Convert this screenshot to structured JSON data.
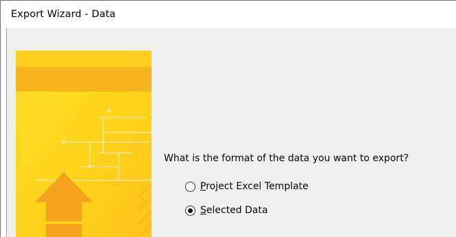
{
  "window": {
    "title": "Export Wizard - Data"
  },
  "banner": {
    "icon": "export-upload-arrow-banner",
    "colors": {
      "top": "#ffd81a",
      "band": "#f7b41c",
      "arrow": "#f5a21c",
      "edge": "#ffc21c"
    }
  },
  "content": {
    "question": "What is the format of the data you want to export?",
    "options": [
      {
        "mnemonic": "P",
        "rest": "roject Excel Template",
        "checked": false
      },
      {
        "mnemonic": "S",
        "rest": "elected Data",
        "checked": true
      }
    ]
  }
}
